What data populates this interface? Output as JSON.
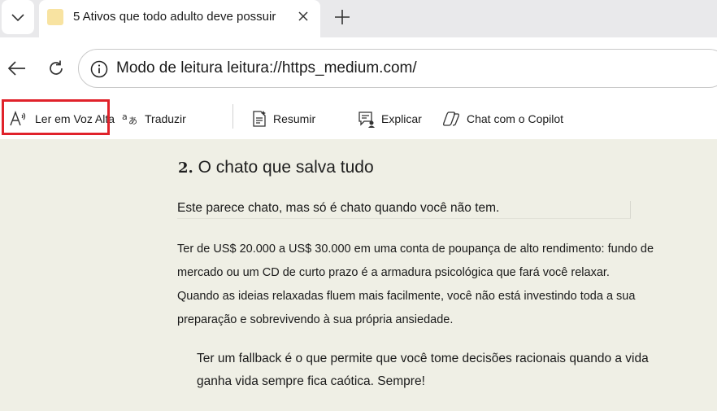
{
  "browser": {
    "tab": {
      "title": "5 Ativos que todo adulto deve possuir"
    },
    "address_bar": {
      "text": "Modo de leitura leitura://https_medium.com/"
    }
  },
  "reader_toolbar": {
    "read_aloud": "Ler em Voz Alta",
    "translate": "Traduzir",
    "summarize": "Resumir",
    "explain": "Explicar",
    "chat": "Chat com o Copilot"
  },
  "article": {
    "heading_number": "2.",
    "heading_text": "O chato que salva tudo",
    "intro": "Este parece chato, mas só é chato quando você não tem.",
    "body_lines": [
      "Ter de US$ 20.000 a US$ 30.000 em uma conta de poupança de alto rendimento: fundo de",
      "mercado ou um CD de curto prazo é a armadura psicológica que fará você relaxar.",
      "Quando as ideias relaxadas fluem mais facilmente, você não está investindo toda a sua",
      "preparação e sobrevivendo à sua própria ansiedade."
    ],
    "quote_lines": [
      "Ter um fallback é o que permite que você tome decisões racionais quando a vida",
      "ganha vida sempre fica caótica. Sempre!"
    ]
  },
  "colors": {
    "reader_background": "#efefe5",
    "highlight_border": "#e0222a",
    "tab_strip": "#e9e9eb"
  }
}
